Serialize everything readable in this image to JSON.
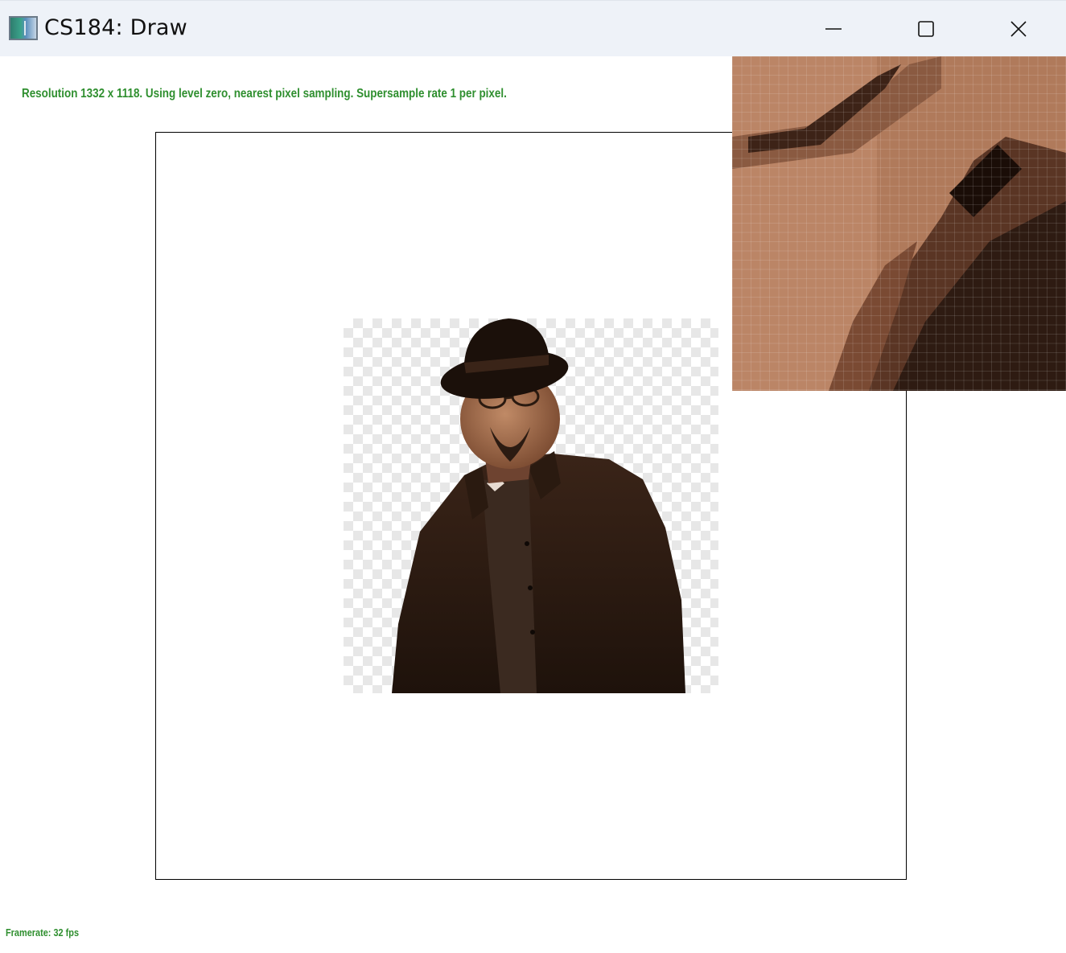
{
  "window": {
    "title": "CS184: Draw",
    "controls": {
      "minimize": "minimize",
      "maximize": "maximize",
      "close": "close"
    }
  },
  "status": {
    "info": "Resolution 1332 x 1118. Using level zero, nearest pixel sampling. Supersample rate 1 per pixel.",
    "framerate": "Framerate: 32 fps"
  },
  "colors": {
    "status_text": "#2f8f2f",
    "titlebar_bg": "#eef2f8",
    "canvas_border": "#000000",
    "checker_light": "#e7e7e7",
    "sepia_dark": "#2a1a10",
    "sepia_mid": "#6a3f28",
    "sepia_light": "#b98363"
  },
  "icons": {
    "app": "app-icon",
    "minimize": "minimize-icon",
    "maximize": "maximize-icon",
    "close": "close-icon"
  }
}
